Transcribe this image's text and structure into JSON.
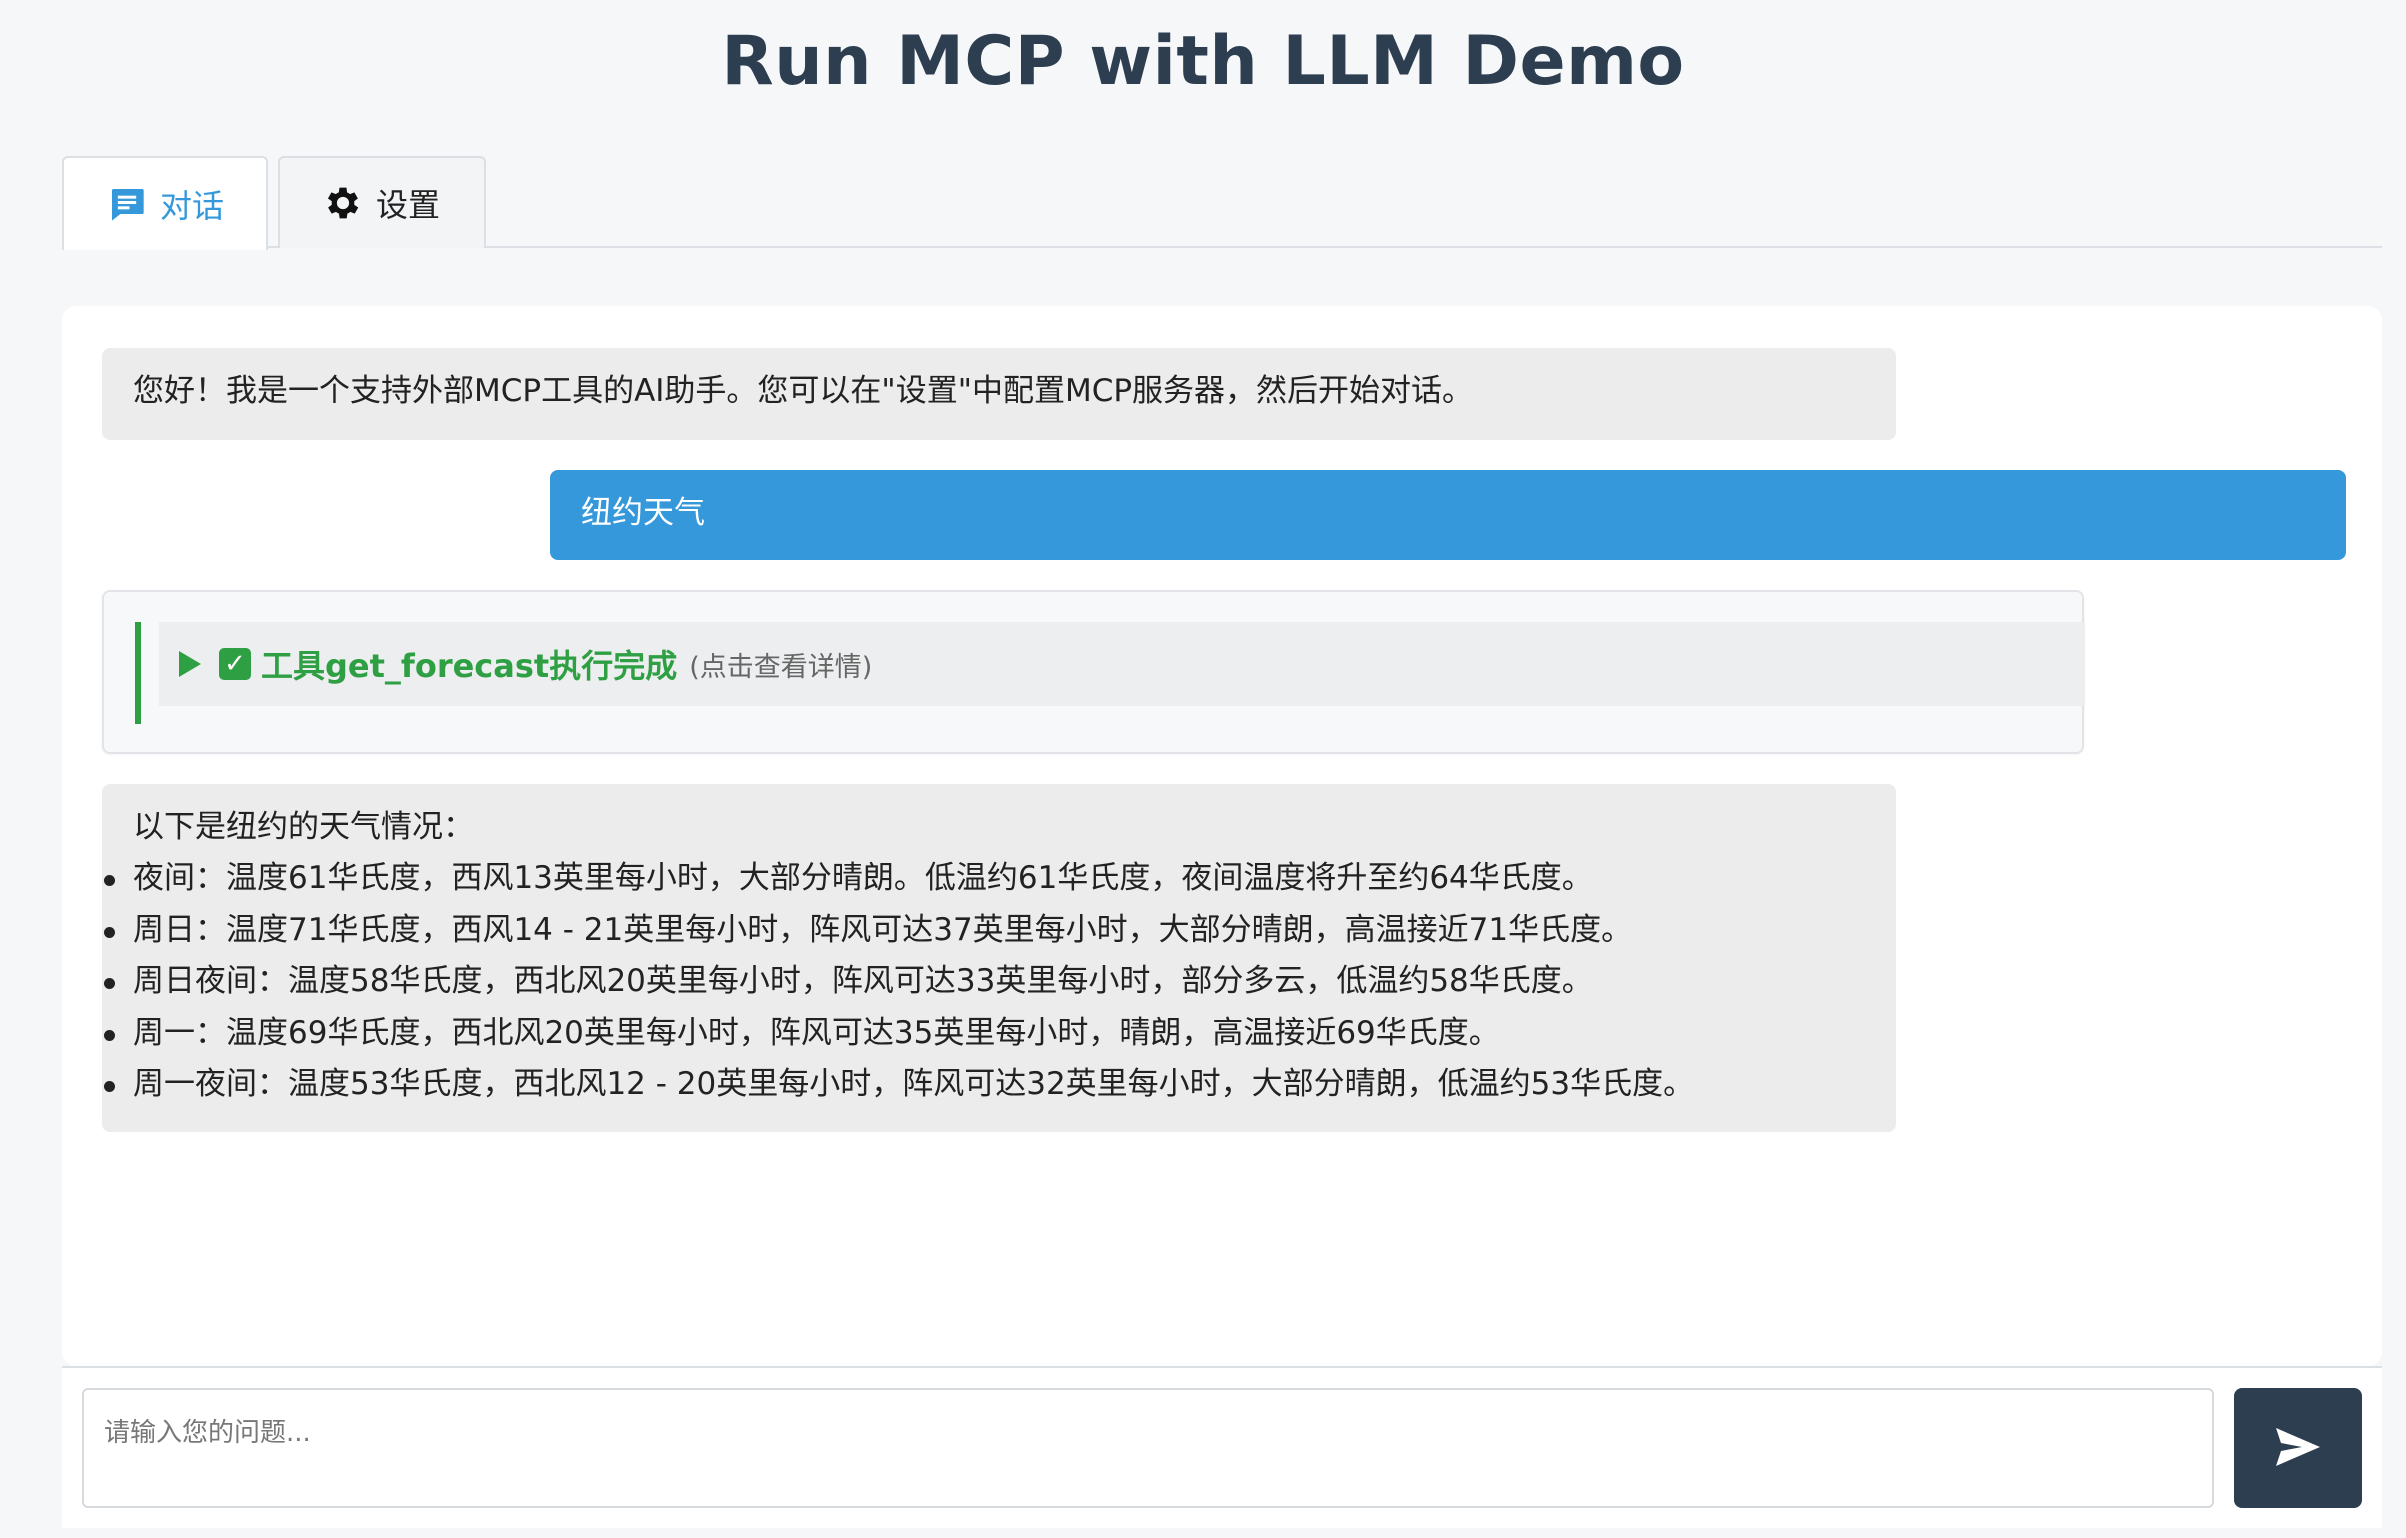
{
  "header": {
    "title": "Run MCP with LLM Demo"
  },
  "tabs": [
    {
      "label": "对话",
      "icon": "chat-icon",
      "active": true
    },
    {
      "label": "设置",
      "icon": "gear-icon",
      "active": false
    }
  ],
  "colors": {
    "accent": "#3498db",
    "success": "#2ea043",
    "dark": "#2c3e50"
  },
  "chat": {
    "welcome": "您好！我是一个支持外部MCP工具的AI助手。您可以在\"设置\"中配置MCP服务器，然后开始对话。",
    "user_message": "纽约天气",
    "tool_call": {
      "icon": "check-icon",
      "title": "工具get_forecast执行完成",
      "hint": "(点击查看详情)"
    },
    "reply": {
      "intro": "以下是纽约的天气情况：",
      "items": [
        "夜间：温度61华氏度，西风13英里每小时，大部分晴朗。低温约61华氏度，夜间温度将升至约64华氏度。",
        "周日：温度71华氏度，西风14 - 21英里每小时，阵风可达37英里每小时，大部分晴朗，高温接近71华氏度。",
        "周日夜间：温度58华氏度，西北风20英里每小时，阵风可达33英里每小时，部分多云，低温约58华氏度。",
        "周一：温度69华氏度，西北风20英里每小时，阵风可达35英里每小时，晴朗，高温接近69华氏度。",
        "周一夜间：温度53华氏度，西北风12 - 20英里每小时，阵风可达32英里每小时，大部分晴朗，低温约53华氏度。"
      ]
    }
  },
  "composer": {
    "placeholder": "请输入您的问题...",
    "send_icon": "send-icon"
  }
}
